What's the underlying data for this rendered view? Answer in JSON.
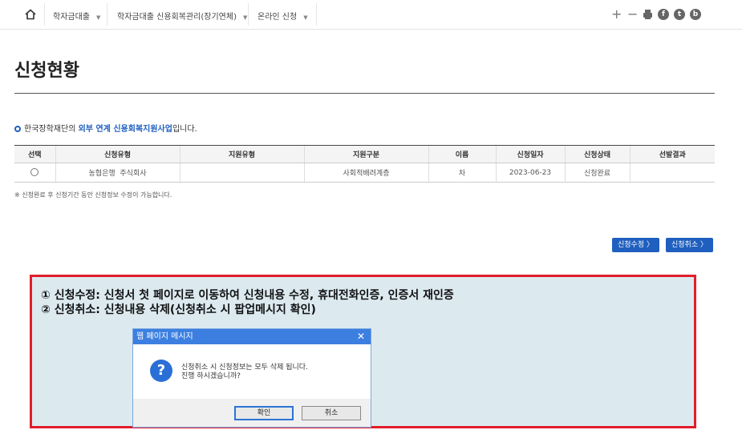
{
  "nav": {
    "crumbs": [
      {
        "label": "학자금대출"
      },
      {
        "label": "학자금대출 신용회복관리(장기연체)"
      },
      {
        "label": "온라인 신청"
      }
    ],
    "plus": "+",
    "minus": "−",
    "social": [
      "f",
      "t",
      "b"
    ]
  },
  "page": {
    "title": "신청현황",
    "intro_prefix": "한국장학재단의 ",
    "intro_highlight": "외부 연계 신용회복지원사업",
    "intro_suffix": "입니다.",
    "note": "※ 신청완료 후 신청기간 동안 신청정보 수정이 가능합니다."
  },
  "table": {
    "headers": [
      "선택",
      "신청유형",
      "지원유형",
      "지원구분",
      "이름",
      "신청일자",
      "신청상태",
      "선발결과"
    ],
    "row": {
      "type": "농협은행  주식회사",
      "support_type": "",
      "category": "사회적배려계층",
      "name": "차",
      "date": "2023-06-23",
      "status": "신청완료",
      "result": ""
    }
  },
  "buttons": {
    "edit": "신청수정 〉",
    "cancel": "신청취소 〉"
  },
  "callout": {
    "line1": "① 신청수정: 신청서 첫 페이지로 이동하여 신청내용 수정, 휴대전화인증, 인증서 재인증",
    "line2": "② 신청취소: 신청내용 삭제(신청취소 시 팝업메시지 확인)"
  },
  "dialog": {
    "title": "웹 페이지 메시지",
    "close": "✕",
    "icon": "?",
    "message1": "신청취소 시 신청정보는 모두 삭제 됩니다.",
    "message2": "진행 하시겠습니까?",
    "ok": "확인",
    "cancel": "취소"
  },
  "colors": {
    "accent": "#1f5fbf",
    "highlight_border": "#e21d2c",
    "callout_bg": "#dceaf0"
  }
}
